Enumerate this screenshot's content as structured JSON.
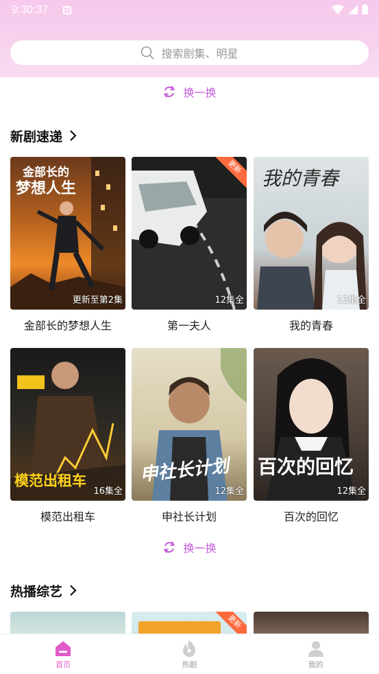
{
  "status_bar": {
    "time": "9:30:37",
    "notification_letter": "A"
  },
  "search": {
    "placeholder": "搜索剧集、明星"
  },
  "refresh_label": "换一换",
  "sections": {
    "new_dramas": {
      "title": "新剧速递",
      "items": [
        {
          "title": "金部长的梦想人生",
          "badge": "更新至第2集",
          "poster_text": "金部长的\n梦想人生",
          "ribbon": ""
        },
        {
          "title": "第一夫人",
          "badge": "12集全",
          "poster_text": "",
          "ribbon": "更新"
        },
        {
          "title": "我的青春",
          "badge": "12集全",
          "poster_text": "我的青春",
          "ribbon": ""
        },
        {
          "title": "模范出租车",
          "badge": "16集全",
          "poster_text": "模范出租车",
          "ribbon": ""
        },
        {
          "title": "申社长计划",
          "badge": "12集全",
          "poster_text": "申社长计划",
          "ribbon": ""
        },
        {
          "title": "百次的回忆",
          "badge": "12集全",
          "poster_text": "百次的回忆",
          "ribbon": ""
        }
      ]
    },
    "variety": {
      "title": "热播综艺",
      "partial_ribbon": "更新"
    }
  },
  "tabbar": [
    {
      "label": "首页",
      "active": true
    },
    {
      "label": "热剧",
      "active": false
    },
    {
      "label": "我的",
      "active": false
    }
  ],
  "colors": {
    "accent": "#e05cc8",
    "refresh": "#c25bd6",
    "ribbon": "#ff6a3d"
  }
}
